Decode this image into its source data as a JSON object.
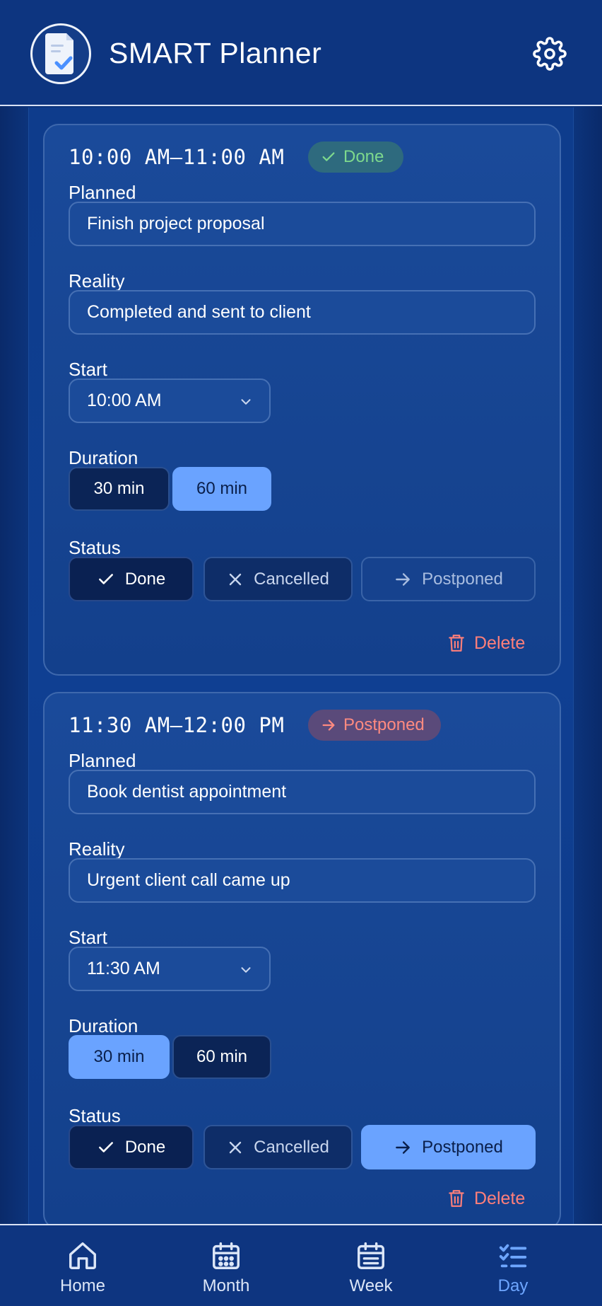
{
  "header": {
    "title": "SMART Planner",
    "logo_icon": "document-check-icon",
    "settings_icon": "gear-icon"
  },
  "colors": {
    "accent": "#6aa3ff",
    "done_green": "#7ed98d",
    "postponed_red": "#ff8a80",
    "delete_red": "#ff7f7a"
  },
  "labels": {
    "planned": "Planned",
    "reality": "Reality",
    "start": "Start",
    "duration": "Duration",
    "status": "Status",
    "delete": "Delete"
  },
  "duration_options": [
    "30 min",
    "60 min"
  ],
  "status_options": [
    "Done",
    "Cancelled",
    "Postponed"
  ],
  "tasks": [
    {
      "time_range": "10:00 AM–11:00 AM",
      "badge": "Done",
      "planned": "Finish project proposal",
      "reality": "Completed and sent to client",
      "start": "10:00 AM",
      "duration_selected": "60 min",
      "status_selected": "Done"
    },
    {
      "time_range": "11:30 AM–12:00 PM",
      "badge": "Postponed",
      "planned": "Book dentist appointment",
      "reality": "Urgent client call came up",
      "start": "11:30 AM",
      "duration_selected": "30 min",
      "status_selected": "Postponed"
    }
  ],
  "nav": {
    "items": [
      {
        "label": "Home",
        "icon": "home-icon"
      },
      {
        "label": "Month",
        "icon": "calendar-month-icon"
      },
      {
        "label": "Week",
        "icon": "calendar-week-icon"
      },
      {
        "label": "Day",
        "icon": "checklist-icon"
      }
    ],
    "active": "Day"
  }
}
